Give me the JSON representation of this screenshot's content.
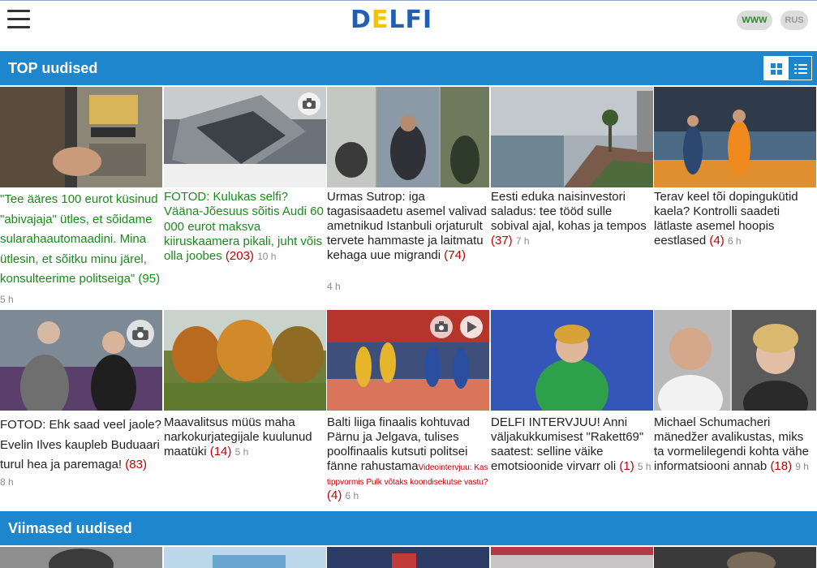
{
  "header": {
    "logo_part1": "D",
    "logo_part2": "E",
    "logo_part3": "LFI",
    "lang_www": "WWW",
    "lang_rus": "RUS"
  },
  "sections": {
    "top_title": "TOP uudised",
    "latest_title": "Viimased uudised"
  },
  "colors": {
    "accent": "#1d86cc",
    "comment_count": "#c00000",
    "green_headline": "#1a8a1a",
    "logo_blue": "#1f5fb5",
    "logo_yellow": "#f5c400"
  },
  "articles_row1": [
    {
      "headline": "\"Tee ääres 100 eurot küsinud \"abivajaja\" ütles, et sõidame sularahaautomaadini. Mina ütlesin, et sõitku minu järel, konsulteerime politseiga\"",
      "comments": "(95)",
      "age": "5 h"
    },
    {
      "headline": "FOTOD: Kulukas selfi? Vääna-Jõesuus sõitis Audi 60 000 eurot maksva kiiruskaamera pikali, juht võis olla joobes",
      "comments": "(203)",
      "age": "10 h"
    },
    {
      "headline": "Urmas Sutrop: iga tagasisaadetu asemel valivad ametnikud Istanbuli orjaturult tervete hammaste ja laitmatu kehaga uue migrandi",
      "comments": "(74)",
      "age": "4 h"
    },
    {
      "headline": "Eesti eduka naisinvestori saladus: tee tööd sulle sobival ajal, kohas ja tempos",
      "comments": "(37)",
      "age": "7 h"
    },
    {
      "headline": "Terav keel tõi dopingukütid kaela? Kontrolli saadeti lätlaste asemel hoopis eestlased",
      "comments": "(4)",
      "age": "6 h"
    }
  ],
  "articles_row2": [
    {
      "headline": "FOTOD: Ehk saad veel jaole? Evelin Ilves kaupleb Buduaari turul hea ja paremaga!",
      "comments": "(83)",
      "age": "8 h"
    },
    {
      "headline": "Maavalitsus müüs maha narkokurjategijale kuulunud maatüki",
      "comments": "(14)",
      "age": "5 h"
    },
    {
      "headline": "Balti liiga finaalis kohtuvad Pärnu ja Jelgava, tulises poolfinaalis kutsuti politsei fänne rahustama",
      "extra": "Videointervjuu: Kas tippvormis Pulk võtaks koondisekutse vastu?",
      "comments": "(4)",
      "age": "6 h"
    },
    {
      "headline": "DELFI INTERVJUU! Anni väljakukkumisest \"Rakett69\" saatest: selline väike emotsioonide virvarr oli",
      "comments": "(1)",
      "age": "5 h"
    },
    {
      "headline": "Michael Schumacheri mänedžer avalikustas, miks ta vormelilegendi kohta vähe informatsiooni annab",
      "comments": "(18)",
      "age": "9 h"
    }
  ],
  "icons": {
    "menu": "hamburger-icon",
    "grid_view": "grid-view-icon",
    "list_view": "list-view-icon",
    "camera": "camera-icon",
    "video": "play-icon"
  }
}
